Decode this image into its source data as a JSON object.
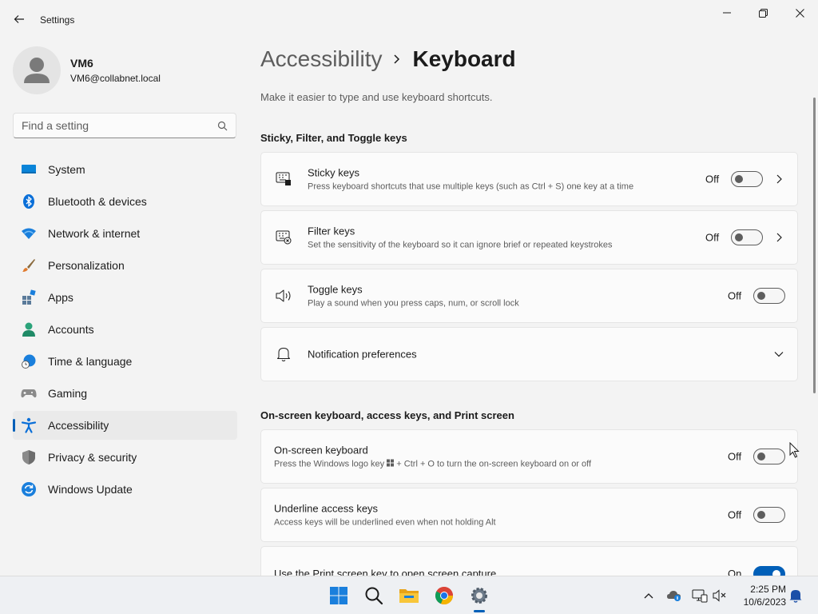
{
  "window": {
    "title": "Settings"
  },
  "profile": {
    "name": "VM6",
    "email": "VM6@collabnet.local"
  },
  "search": {
    "placeholder": "Find a setting"
  },
  "sidebar": {
    "items": [
      {
        "label": "System",
        "icon": "system-icon"
      },
      {
        "label": "Bluetooth & devices",
        "icon": "bluetooth-icon"
      },
      {
        "label": "Network & internet",
        "icon": "wifi-icon"
      },
      {
        "label": "Personalization",
        "icon": "brush-icon"
      },
      {
        "label": "Apps",
        "icon": "apps-icon"
      },
      {
        "label": "Accounts",
        "icon": "accounts-icon"
      },
      {
        "label": "Time & language",
        "icon": "time-language-icon"
      },
      {
        "label": "Gaming",
        "icon": "gamepad-icon"
      },
      {
        "label": "Accessibility",
        "icon": "accessibility-icon",
        "active": true
      },
      {
        "label": "Privacy & security",
        "icon": "shield-icon"
      },
      {
        "label": "Windows Update",
        "icon": "update-icon"
      }
    ]
  },
  "main": {
    "breadcrumb": {
      "parent": "Accessibility",
      "current": "Keyboard"
    },
    "description": "Make it easier to type and use keyboard shortcuts.",
    "sections": [
      {
        "title": "Sticky, Filter, and Toggle keys",
        "items": [
          {
            "title": "Sticky keys",
            "desc": "Press keyboard shortcuts that use multiple keys (such as Ctrl + S) one key at a time",
            "state": "Off",
            "on": false,
            "chevron": true
          },
          {
            "title": "Filter keys",
            "desc": "Set the sensitivity of the keyboard so it can ignore brief or repeated keystrokes",
            "state": "Off",
            "on": false,
            "chevron": true
          },
          {
            "title": "Toggle keys",
            "desc": "Play a sound when you press caps, num, or scroll lock",
            "state": "Off",
            "on": false
          },
          {
            "title": "Notification preferences"
          }
        ]
      },
      {
        "title": "On-screen keyboard, access keys, and Print screen",
        "items": [
          {
            "title": "On-screen keyboard",
            "desc_before": "Press the Windows logo key",
            "desc_after": "+ Ctrl + O to turn the on-screen keyboard on or off",
            "state": "Off",
            "on": false
          },
          {
            "title": "Underline access keys",
            "desc": "Access keys will be underlined even when not holding Alt",
            "state": "Off",
            "on": false
          },
          {
            "title": "Use the Print screen key to open screen capture",
            "state": "On",
            "on": true
          }
        ]
      }
    ]
  },
  "taskbar": {
    "apps": [
      "windows-start-icon",
      "search-icon",
      "file-explorer-icon",
      "chrome-icon",
      "settings-icon"
    ],
    "clock": {
      "time": "2:25 PM",
      "date": "10/6/2023"
    }
  },
  "colors": {
    "accent": "#005fb8",
    "background": "#f3f3f3",
    "card": "#fbfbfb"
  }
}
